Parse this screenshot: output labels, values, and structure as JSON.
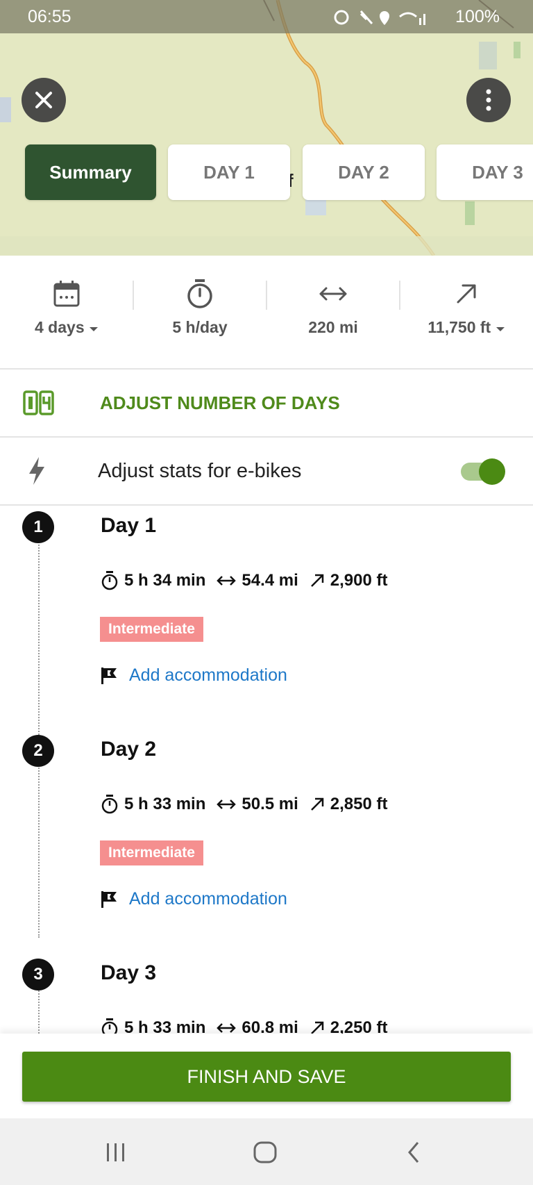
{
  "status_bar": {
    "time": "06:55",
    "battery": "100%"
  },
  "map_label": "f",
  "tabs": [
    {
      "label": "Summary",
      "active": true
    },
    {
      "label": "DAY 1",
      "active": false
    },
    {
      "label": "DAY 2",
      "active": false
    },
    {
      "label": "DAY 3",
      "active": false
    }
  ],
  "summary_stats": {
    "days": "4 days",
    "duration": "5 h/day",
    "distance": "220 mi",
    "elevation": "11,750 ft"
  },
  "adjust_days_label": "ADJUST NUMBER OF DAYS",
  "ebike": {
    "label": "Adjust stats for e-bikes",
    "enabled": true
  },
  "days": [
    {
      "number": "1",
      "title": "Day 1",
      "duration": "5 h 34 min",
      "distance": "54.4 mi",
      "elevation": "2,900 ft",
      "difficulty": "Intermediate",
      "accommodation_link": "Add accommodation"
    },
    {
      "number": "2",
      "title": "Day 2",
      "duration": "5 h 33 min",
      "distance": "50.5 mi",
      "elevation": "2,850 ft",
      "difficulty": "Intermediate",
      "accommodation_link": "Add accommodation"
    },
    {
      "number": "3",
      "title": "Day 3",
      "duration": "5 h 33 min",
      "distance": "60.8 mi",
      "elevation": "2,250 ft"
    }
  ],
  "finish_button": "FINISH AND SAVE",
  "colors": {
    "accent_green": "#4b8a13",
    "dark_green": "#2f5430",
    "badge_red": "#f58f8f",
    "link_blue": "#1e78c8"
  }
}
